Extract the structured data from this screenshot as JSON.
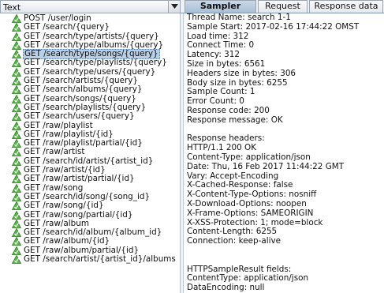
{
  "left": {
    "renderer": "Text",
    "tree": [
      {
        "label": "POST /user/login",
        "selected": false
      },
      {
        "label": "GET /search/{query}",
        "selected": false
      },
      {
        "label": "GET /search/type/artists/{query}",
        "selected": false
      },
      {
        "label": "GET /search/type/albums/{query}",
        "selected": false
      },
      {
        "label": "GET /search/type/songs/{query}",
        "selected": true
      },
      {
        "label": "GET /search/type/playlists/{query}",
        "selected": false
      },
      {
        "label": "GET /search/type/users/{query}",
        "selected": false
      },
      {
        "label": "GET /search/artists/{query}",
        "selected": false
      },
      {
        "label": "GET /search/albums/{query}",
        "selected": false
      },
      {
        "label": "GET /search/songs/{query}",
        "selected": false
      },
      {
        "label": "GET /search/playlists/{query}",
        "selected": false
      },
      {
        "label": "GET /search/users/{query}",
        "selected": false
      },
      {
        "label": "GET /raw/playlist",
        "selected": false
      },
      {
        "label": "GET /raw/playlist/{id}",
        "selected": false
      },
      {
        "label": "GET /raw/playlist/partial/{id}",
        "selected": false
      },
      {
        "label": "GET /raw/artist",
        "selected": false
      },
      {
        "label": "GET /search/id/artist/{artist_id}",
        "selected": false
      },
      {
        "label": "GET /raw/artist/{id}",
        "selected": false
      },
      {
        "label": "GET /raw/artist/partial/{id}",
        "selected": false
      },
      {
        "label": "GET /raw/song",
        "selected": false
      },
      {
        "label": "GET /search/id/song/{song_id}",
        "selected": false
      },
      {
        "label": "GET /raw/song/{id}",
        "selected": false
      },
      {
        "label": "GET /raw/song/partial/{id}",
        "selected": false
      },
      {
        "label": "GET /raw/album",
        "selected": false
      },
      {
        "label": "GET /search/id/album/{album_id}",
        "selected": false
      },
      {
        "label": "GET /raw/album/{id}",
        "selected": false
      },
      {
        "label": "GET /raw/album/partial/{id}",
        "selected": false
      },
      {
        "label": "GET /search/artist/{artist_id}/albums",
        "selected": false
      }
    ]
  },
  "right": {
    "tabs": [
      {
        "label": "Sampler result",
        "active": true
      },
      {
        "label": "Request",
        "active": false
      },
      {
        "label": "Response data",
        "active": false
      }
    ],
    "lines": [
      "Thread Name: search 1-1",
      "Sample Start: 2017-02-16 17:44:22 OMST",
      "Load time: 312",
      "Connect Time: 0",
      "Latency: 312",
      "Size in bytes: 6561",
      "Headers size in bytes: 306",
      "Body size in bytes: 6255",
      "Sample Count: 1",
      "Error Count: 0",
      "Response code: 200",
      "Response message: OK",
      "",
      "Response headers:",
      "HTTP/1.1 200 OK",
      "Content-Type: application/json",
      "Date: Thu, 16 Feb 2017 11:44:22 GMT",
      "Vary: Accept-Encoding",
      "X-Cached-Response: false",
      "X-Content-Type-Options: nosniff",
      "X-Download-Options: noopen",
      "X-Frame-Options: SAMEORIGIN",
      "X-XSS-Protection: 1; mode=block",
      "Content-Length: 6255",
      "Connection: keep-alive",
      "",
      "",
      "HTTPSampleResult fields:",
      "ContentType: application/json",
      "DataEncoding: null"
    ]
  },
  "colors": {
    "success_icon": "#3f9a2f",
    "selection": "#b8cfe5",
    "active_tab": "#b3c7dc"
  }
}
